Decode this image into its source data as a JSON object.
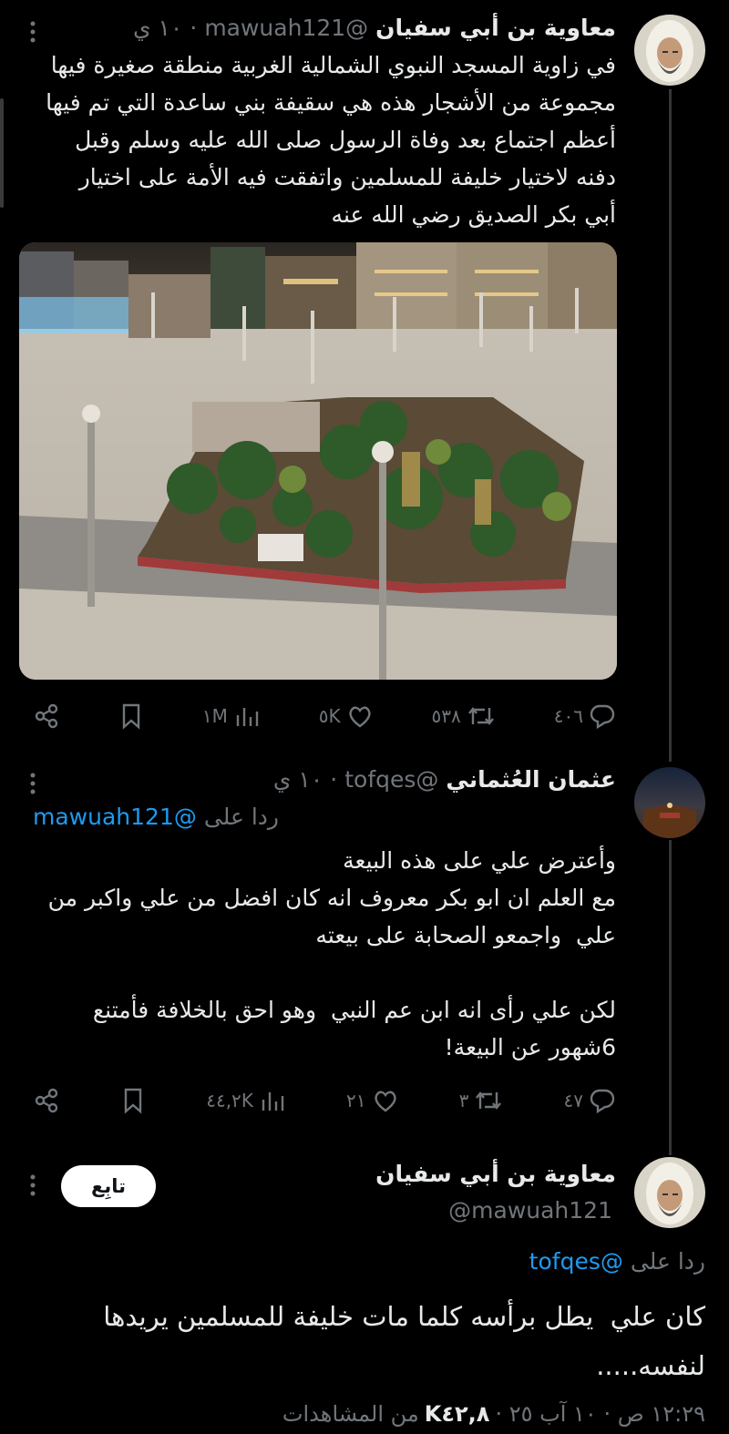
{
  "tweet1": {
    "name": "معاوية بن أبي سفيان",
    "handle": "@mawuah121",
    "time": "١٠ ي",
    "text": "في زاوية المسجد النبوي الشمالية الغربية منطقة صغيرة فيها\nمجموعة من الأشجار هذه هي سقيفة بني ساعدة التي تم فيها\nأعظم اجتماع بعد وفاة الرسول صلى الله عليه وسلم وقبل\nدفنه لاختيار خليفة للمسلمين واتفقت فيه الأمة على اختيار\nأبي بكر الصديق رضي الله عنه",
    "actions": {
      "replies": "٤٠٦",
      "reposts": "٥٣٨",
      "likes": "٥K",
      "views": "١M"
    }
  },
  "tweet2": {
    "name": "عثمان العُثماني",
    "handle": "@tofqes",
    "time": "١٠ ي",
    "reply_label": "ردا على",
    "reply_to": "@mawuah121",
    "text": "وأعترض علي على هذه البيعة\nمع العلم ان ابو بكر معروف انه كان افضل من علي واكبر من\nعلي  واجمعو الصحابة على بيعته\n\nلكن علي رأى انه ابن عم النبي  وهو احق بالخلافة فأمتنع\n6شهور عن البيعة!",
    "actions": {
      "replies": "٤٧",
      "reposts": "٣",
      "likes": "٢١",
      "views": "٤٤,٢K"
    }
  },
  "tweet3": {
    "name": "معاوية بن أبي سفيان",
    "handle": "@mawuah121",
    "follow_label": "تابِع",
    "reply_label": "ردا على",
    "reply_to": "@tofqes",
    "text": "كان علي  يطل برأسه كلما مات خليفة للمسلمين يريدها\nلنفسه.....",
    "meta_time": "١٢:٢٩ ص · ١٠ آب ٢٥ ·",
    "meta_views": "K٤٢,٨",
    "meta_views_label": "من المشاهدات"
  }
}
